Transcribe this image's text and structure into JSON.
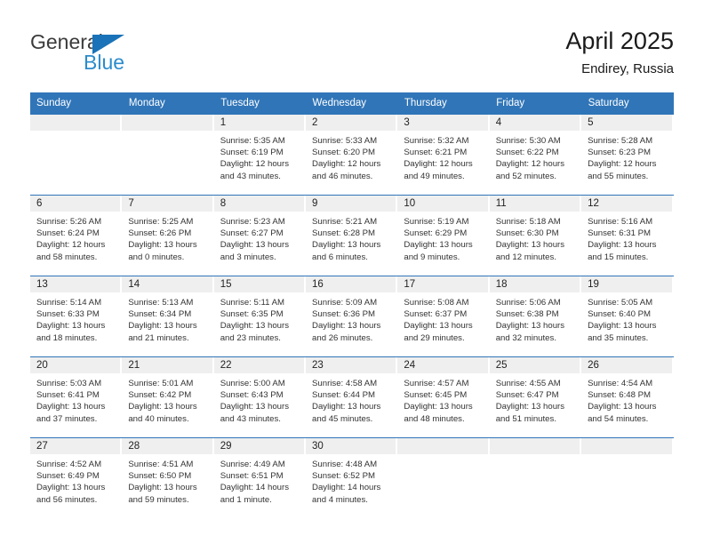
{
  "brand": {
    "name_top": "General",
    "name_bottom": "Blue",
    "accent_color": "#2b8ccc",
    "triangle_color": "#1a73b8"
  },
  "header": {
    "title": "April 2025",
    "subtitle": "Endirey, Russia"
  },
  "calendar": {
    "header_color": "#3075b8",
    "daynum_band_color": "#efefef",
    "weekday_headers": [
      "Sunday",
      "Monday",
      "Tuesday",
      "Wednesday",
      "Thursday",
      "Friday",
      "Saturday"
    ],
    "weeks": [
      [
        {
          "day": "",
          "sunrise": "",
          "sunset": "",
          "daylight1": "",
          "daylight2": ""
        },
        {
          "day": "",
          "sunrise": "",
          "sunset": "",
          "daylight1": "",
          "daylight2": ""
        },
        {
          "day": "1",
          "sunrise": "Sunrise: 5:35 AM",
          "sunset": "Sunset: 6:19 PM",
          "daylight1": "Daylight: 12 hours",
          "daylight2": "and 43 minutes."
        },
        {
          "day": "2",
          "sunrise": "Sunrise: 5:33 AM",
          "sunset": "Sunset: 6:20 PM",
          "daylight1": "Daylight: 12 hours",
          "daylight2": "and 46 minutes."
        },
        {
          "day": "3",
          "sunrise": "Sunrise: 5:32 AM",
          "sunset": "Sunset: 6:21 PM",
          "daylight1": "Daylight: 12 hours",
          "daylight2": "and 49 minutes."
        },
        {
          "day": "4",
          "sunrise": "Sunrise: 5:30 AM",
          "sunset": "Sunset: 6:22 PM",
          "daylight1": "Daylight: 12 hours",
          "daylight2": "and 52 minutes."
        },
        {
          "day": "5",
          "sunrise": "Sunrise: 5:28 AM",
          "sunset": "Sunset: 6:23 PM",
          "daylight1": "Daylight: 12 hours",
          "daylight2": "and 55 minutes."
        }
      ],
      [
        {
          "day": "6",
          "sunrise": "Sunrise: 5:26 AM",
          "sunset": "Sunset: 6:24 PM",
          "daylight1": "Daylight: 12 hours",
          "daylight2": "and 58 minutes."
        },
        {
          "day": "7",
          "sunrise": "Sunrise: 5:25 AM",
          "sunset": "Sunset: 6:26 PM",
          "daylight1": "Daylight: 13 hours",
          "daylight2": "and 0 minutes."
        },
        {
          "day": "8",
          "sunrise": "Sunrise: 5:23 AM",
          "sunset": "Sunset: 6:27 PM",
          "daylight1": "Daylight: 13 hours",
          "daylight2": "and 3 minutes."
        },
        {
          "day": "9",
          "sunrise": "Sunrise: 5:21 AM",
          "sunset": "Sunset: 6:28 PM",
          "daylight1": "Daylight: 13 hours",
          "daylight2": "and 6 minutes."
        },
        {
          "day": "10",
          "sunrise": "Sunrise: 5:19 AM",
          "sunset": "Sunset: 6:29 PM",
          "daylight1": "Daylight: 13 hours",
          "daylight2": "and 9 minutes."
        },
        {
          "day": "11",
          "sunrise": "Sunrise: 5:18 AM",
          "sunset": "Sunset: 6:30 PM",
          "daylight1": "Daylight: 13 hours",
          "daylight2": "and 12 minutes."
        },
        {
          "day": "12",
          "sunrise": "Sunrise: 5:16 AM",
          "sunset": "Sunset: 6:31 PM",
          "daylight1": "Daylight: 13 hours",
          "daylight2": "and 15 minutes."
        }
      ],
      [
        {
          "day": "13",
          "sunrise": "Sunrise: 5:14 AM",
          "sunset": "Sunset: 6:33 PM",
          "daylight1": "Daylight: 13 hours",
          "daylight2": "and 18 minutes."
        },
        {
          "day": "14",
          "sunrise": "Sunrise: 5:13 AM",
          "sunset": "Sunset: 6:34 PM",
          "daylight1": "Daylight: 13 hours",
          "daylight2": "and 21 minutes."
        },
        {
          "day": "15",
          "sunrise": "Sunrise: 5:11 AM",
          "sunset": "Sunset: 6:35 PM",
          "daylight1": "Daylight: 13 hours",
          "daylight2": "and 23 minutes."
        },
        {
          "day": "16",
          "sunrise": "Sunrise: 5:09 AM",
          "sunset": "Sunset: 6:36 PM",
          "daylight1": "Daylight: 13 hours",
          "daylight2": "and 26 minutes."
        },
        {
          "day": "17",
          "sunrise": "Sunrise: 5:08 AM",
          "sunset": "Sunset: 6:37 PM",
          "daylight1": "Daylight: 13 hours",
          "daylight2": "and 29 minutes."
        },
        {
          "day": "18",
          "sunrise": "Sunrise: 5:06 AM",
          "sunset": "Sunset: 6:38 PM",
          "daylight1": "Daylight: 13 hours",
          "daylight2": "and 32 minutes."
        },
        {
          "day": "19",
          "sunrise": "Sunrise: 5:05 AM",
          "sunset": "Sunset: 6:40 PM",
          "daylight1": "Daylight: 13 hours",
          "daylight2": "and 35 minutes."
        }
      ],
      [
        {
          "day": "20",
          "sunrise": "Sunrise: 5:03 AM",
          "sunset": "Sunset: 6:41 PM",
          "daylight1": "Daylight: 13 hours",
          "daylight2": "and 37 minutes."
        },
        {
          "day": "21",
          "sunrise": "Sunrise: 5:01 AM",
          "sunset": "Sunset: 6:42 PM",
          "daylight1": "Daylight: 13 hours",
          "daylight2": "and 40 minutes."
        },
        {
          "day": "22",
          "sunrise": "Sunrise: 5:00 AM",
          "sunset": "Sunset: 6:43 PM",
          "daylight1": "Daylight: 13 hours",
          "daylight2": "and 43 minutes."
        },
        {
          "day": "23",
          "sunrise": "Sunrise: 4:58 AM",
          "sunset": "Sunset: 6:44 PM",
          "daylight1": "Daylight: 13 hours",
          "daylight2": "and 45 minutes."
        },
        {
          "day": "24",
          "sunrise": "Sunrise: 4:57 AM",
          "sunset": "Sunset: 6:45 PM",
          "daylight1": "Daylight: 13 hours",
          "daylight2": "and 48 minutes."
        },
        {
          "day": "25",
          "sunrise": "Sunrise: 4:55 AM",
          "sunset": "Sunset: 6:47 PM",
          "daylight1": "Daylight: 13 hours",
          "daylight2": "and 51 minutes."
        },
        {
          "day": "26",
          "sunrise": "Sunrise: 4:54 AM",
          "sunset": "Sunset: 6:48 PM",
          "daylight1": "Daylight: 13 hours",
          "daylight2": "and 54 minutes."
        }
      ],
      [
        {
          "day": "27",
          "sunrise": "Sunrise: 4:52 AM",
          "sunset": "Sunset: 6:49 PM",
          "daylight1": "Daylight: 13 hours",
          "daylight2": "and 56 minutes."
        },
        {
          "day": "28",
          "sunrise": "Sunrise: 4:51 AM",
          "sunset": "Sunset: 6:50 PM",
          "daylight1": "Daylight: 13 hours",
          "daylight2": "and 59 minutes."
        },
        {
          "day": "29",
          "sunrise": "Sunrise: 4:49 AM",
          "sunset": "Sunset: 6:51 PM",
          "daylight1": "Daylight: 14 hours",
          "daylight2": "and 1 minute."
        },
        {
          "day": "30",
          "sunrise": "Sunrise: 4:48 AM",
          "sunset": "Sunset: 6:52 PM",
          "daylight1": "Daylight: 14 hours",
          "daylight2": "and 4 minutes."
        },
        {
          "day": "",
          "sunrise": "",
          "sunset": "",
          "daylight1": "",
          "daylight2": ""
        },
        {
          "day": "",
          "sunrise": "",
          "sunset": "",
          "daylight1": "",
          "daylight2": ""
        },
        {
          "day": "",
          "sunrise": "",
          "sunset": "",
          "daylight1": "",
          "daylight2": ""
        }
      ]
    ]
  }
}
